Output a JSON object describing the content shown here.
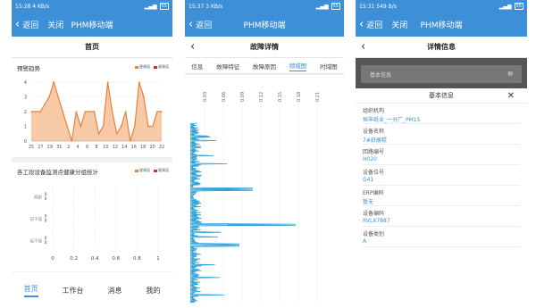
{
  "phone1": {
    "status": {
      "time": "15:28",
      "net": "4 KB/s"
    },
    "nav": {
      "back": "返回",
      "close": "关闭",
      "title": "PHM移动端"
    },
    "header": "首页",
    "trend": {
      "title": "预警趋势",
      "legend": [
        "健康值",
        "健康值"
      ]
    },
    "bars": {
      "title": "各工段设备监测点健康分组统计",
      "legend": [
        "健康值",
        "健康值"
      ]
    },
    "tabbar": [
      "首页",
      "工作台",
      "消息",
      "我的"
    ]
  },
  "phone2": {
    "status": {
      "time": "15:37",
      "net": "3 KB/s"
    },
    "nav": {
      "back": "返回",
      "title": "PHM移动端"
    },
    "header": "故障详情",
    "tabs": [
      "信息",
      "故障特征",
      "故障原因",
      "频域图",
      "时域图"
    ],
    "active_tab": 3,
    "axis_ticks": [
      "0.03",
      "0.06",
      "0.09",
      "0.12",
      "0.15",
      "0.18",
      "0.21"
    ]
  },
  "phone3": {
    "status": {
      "time": "15:31",
      "net": "549 B/s"
    },
    "nav": {
      "back": "返回",
      "close": "关闭",
      "title": "PHM移动端"
    },
    "header": "详情信息",
    "section_label": "基本信息",
    "modal_title": "基本信息",
    "fields": [
      {
        "label": "组织机构",
        "value": "恒丰纸业_一分厂_PM15"
      },
      {
        "label": "设备名称",
        "value": "7#舒展辊"
      },
      {
        "label": "回路编号",
        "value": "H020"
      },
      {
        "label": "设备位号",
        "value": "G41"
      },
      {
        "label": "ERP编码",
        "value": "暂无"
      },
      {
        "label": "设备编码",
        "value": "RVLX7887"
      },
      {
        "label": "设备类别",
        "value": "A"
      }
    ]
  },
  "chart_data": [
    {
      "type": "area",
      "title": "预警趋势",
      "categories": [
        "25",
        "27",
        "29",
        "31",
        "2",
        "4",
        "6",
        "8",
        "10",
        "12",
        "14",
        "16",
        "18",
        "20",
        "22"
      ],
      "tick_labels": [
        "25",
        "27",
        "29",
        "31",
        "2",
        "4",
        "6",
        "8",
        "10",
        "12",
        "14",
        "16",
        "18",
        "20",
        "22"
      ],
      "values": [
        2,
        2,
        2,
        2.5,
        3,
        4,
        3,
        2,
        1,
        0,
        2,
        1,
        2,
        2,
        2,
        0.5,
        1,
        4,
        2,
        0.5,
        1,
        2,
        0,
        1,
        4,
        3,
        1,
        1,
        2,
        2
      ],
      "ylim": [
        0,
        4
      ],
      "yticks": [
        "0",
        "1",
        "2",
        "3",
        "4"
      ],
      "fill": "#f7c9a7",
      "line": "#e8813a"
    },
    {
      "type": "bar",
      "title": "各工段设备监测点健康分组统计",
      "orientation": "horizontal",
      "categories": [
        "网部",
        "前干燥",
        "后干燥"
      ],
      "xticks": [
        "0",
        "0.2",
        "0.4",
        "0.6",
        "0.8",
        "1"
      ],
      "series": [
        {
          "values": [
            0,
            0,
            0
          ]
        },
        {
          "values": [
            0,
            0,
            0
          ]
        }
      ],
      "xlim": [
        0,
        1
      ]
    }
  ]
}
